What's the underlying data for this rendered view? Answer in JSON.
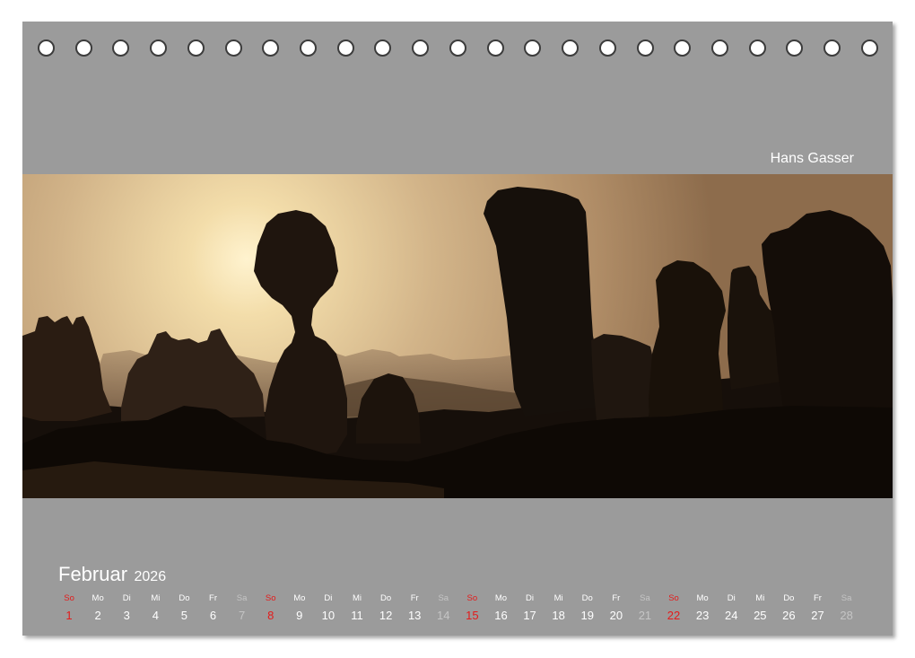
{
  "author": "Hans Gasser",
  "month": {
    "name": "Februar",
    "year": "2026"
  },
  "days": [
    {
      "dow": "So",
      "num": "1",
      "type": "sun"
    },
    {
      "dow": "Mo",
      "num": "2",
      "type": "weekday"
    },
    {
      "dow": "Di",
      "num": "3",
      "type": "weekday"
    },
    {
      "dow": "Mi",
      "num": "4",
      "type": "weekday"
    },
    {
      "dow": "Do",
      "num": "5",
      "type": "weekday"
    },
    {
      "dow": "Fr",
      "num": "6",
      "type": "weekday"
    },
    {
      "dow": "Sa",
      "num": "7",
      "type": "sat"
    },
    {
      "dow": "So",
      "num": "8",
      "type": "sun"
    },
    {
      "dow": "Mo",
      "num": "9",
      "type": "weekday"
    },
    {
      "dow": "Di",
      "num": "10",
      "type": "weekday"
    },
    {
      "dow": "Mi",
      "num": "11",
      "type": "weekday"
    },
    {
      "dow": "Do",
      "num": "12",
      "type": "weekday"
    },
    {
      "dow": "Fr",
      "num": "13",
      "type": "weekday"
    },
    {
      "dow": "Sa",
      "num": "14",
      "type": "sat"
    },
    {
      "dow": "So",
      "num": "15",
      "type": "sun"
    },
    {
      "dow": "Mo",
      "num": "16",
      "type": "weekday"
    },
    {
      "dow": "Di",
      "num": "17",
      "type": "weekday"
    },
    {
      "dow": "Mi",
      "num": "18",
      "type": "weekday"
    },
    {
      "dow": "Do",
      "num": "19",
      "type": "weekday"
    },
    {
      "dow": "Fr",
      "num": "20",
      "type": "weekday"
    },
    {
      "dow": "Sa",
      "num": "21",
      "type": "sat"
    },
    {
      "dow": "So",
      "num": "22",
      "type": "sun"
    },
    {
      "dow": "Mo",
      "num": "23",
      "type": "weekday"
    },
    {
      "dow": "Di",
      "num": "24",
      "type": "weekday"
    },
    {
      "dow": "Mi",
      "num": "25",
      "type": "weekday"
    },
    {
      "dow": "Do",
      "num": "26",
      "type": "weekday"
    },
    {
      "dow": "Fr",
      "num": "27",
      "type": "weekday"
    },
    {
      "dow": "Sa",
      "num": "28",
      "type": "sat"
    }
  ],
  "colors": {
    "page_background": "#9b9b9b",
    "sunday": "#e41b1b",
    "saturday": "#c5c5c5",
    "text": "#ffffff"
  }
}
